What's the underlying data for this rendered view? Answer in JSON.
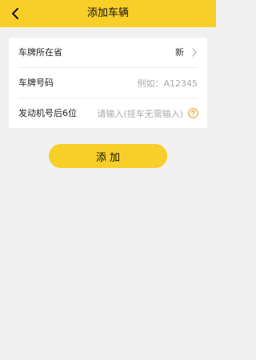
{
  "header": {
    "title": "添加车辆"
  },
  "form": {
    "province": {
      "label": "车牌所在省",
      "value": "新"
    },
    "plate": {
      "label": "车牌号码",
      "value": "",
      "placeholder": "例如：A12345"
    },
    "engine": {
      "label": "发动机号后6位",
      "value": "",
      "placeholder": "请输入(挂车无需输入)"
    }
  },
  "actions": {
    "add_label": "添加"
  },
  "colors": {
    "accent": "#f8ce28",
    "help_icon": "#f0a020"
  }
}
